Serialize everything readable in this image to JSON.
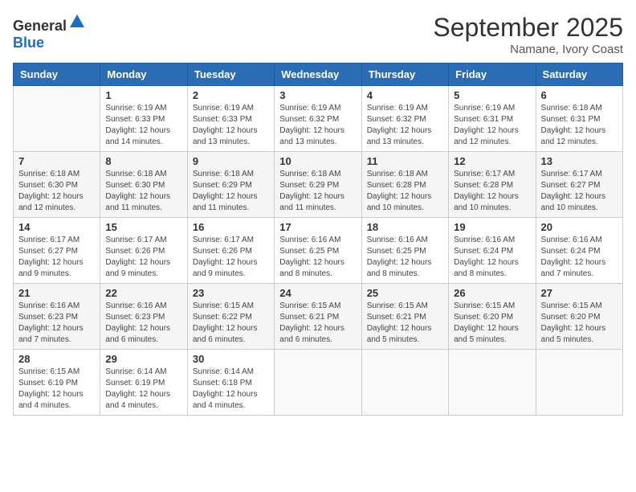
{
  "logo": {
    "general": "General",
    "blue": "Blue"
  },
  "title": "September 2025",
  "location": "Namane, Ivory Coast",
  "days_of_week": [
    "Sunday",
    "Monday",
    "Tuesday",
    "Wednesday",
    "Thursday",
    "Friday",
    "Saturday"
  ],
  "weeks": [
    [
      {
        "day": "",
        "info": ""
      },
      {
        "day": "1",
        "info": "Sunrise: 6:19 AM\nSunset: 6:33 PM\nDaylight: 12 hours\nand 14 minutes."
      },
      {
        "day": "2",
        "info": "Sunrise: 6:19 AM\nSunset: 6:33 PM\nDaylight: 12 hours\nand 13 minutes."
      },
      {
        "day": "3",
        "info": "Sunrise: 6:19 AM\nSunset: 6:32 PM\nDaylight: 12 hours\nand 13 minutes."
      },
      {
        "day": "4",
        "info": "Sunrise: 6:19 AM\nSunset: 6:32 PM\nDaylight: 12 hours\nand 13 minutes."
      },
      {
        "day": "5",
        "info": "Sunrise: 6:19 AM\nSunset: 6:31 PM\nDaylight: 12 hours\nand 12 minutes."
      },
      {
        "day": "6",
        "info": "Sunrise: 6:18 AM\nSunset: 6:31 PM\nDaylight: 12 hours\nand 12 minutes."
      }
    ],
    [
      {
        "day": "7",
        "info": ""
      },
      {
        "day": "8",
        "info": "Sunrise: 6:18 AM\nSunset: 6:30 PM\nDaylight: 12 hours\nand 11 minutes."
      },
      {
        "day": "9",
        "info": "Sunrise: 6:18 AM\nSunset: 6:29 PM\nDaylight: 12 hours\nand 11 minutes."
      },
      {
        "day": "10",
        "info": "Sunrise: 6:18 AM\nSunset: 6:29 PM\nDaylight: 12 hours\nand 11 minutes."
      },
      {
        "day": "11",
        "info": "Sunrise: 6:18 AM\nSunset: 6:28 PM\nDaylight: 12 hours\nand 10 minutes."
      },
      {
        "day": "12",
        "info": "Sunrise: 6:17 AM\nSunset: 6:28 PM\nDaylight: 12 hours\nand 10 minutes."
      },
      {
        "day": "13",
        "info": "Sunrise: 6:17 AM\nSunset: 6:27 PM\nDaylight: 12 hours\nand 10 minutes."
      }
    ],
    [
      {
        "day": "14",
        "info": ""
      },
      {
        "day": "15",
        "info": "Sunrise: 6:17 AM\nSunset: 6:26 PM\nDaylight: 12 hours\nand 9 minutes."
      },
      {
        "day": "16",
        "info": "Sunrise: 6:17 AM\nSunset: 6:26 PM\nDaylight: 12 hours\nand 9 minutes."
      },
      {
        "day": "17",
        "info": "Sunrise: 6:16 AM\nSunset: 6:25 PM\nDaylight: 12 hours\nand 8 minutes."
      },
      {
        "day": "18",
        "info": "Sunrise: 6:16 AM\nSunset: 6:25 PM\nDaylight: 12 hours\nand 8 minutes."
      },
      {
        "day": "19",
        "info": "Sunrise: 6:16 AM\nSunset: 6:24 PM\nDaylight: 12 hours\nand 8 minutes."
      },
      {
        "day": "20",
        "info": "Sunrise: 6:16 AM\nSunset: 6:24 PM\nDaylight: 12 hours\nand 7 minutes."
      }
    ],
    [
      {
        "day": "21",
        "info": ""
      },
      {
        "day": "22",
        "info": "Sunrise: 6:16 AM\nSunset: 6:23 PM\nDaylight: 12 hours\nand 6 minutes."
      },
      {
        "day": "23",
        "info": "Sunrise: 6:15 AM\nSunset: 6:22 PM\nDaylight: 12 hours\nand 6 minutes."
      },
      {
        "day": "24",
        "info": "Sunrise: 6:15 AM\nSunset: 6:21 PM\nDaylight: 12 hours\nand 6 minutes."
      },
      {
        "day": "25",
        "info": "Sunrise: 6:15 AM\nSunset: 6:21 PM\nDaylight: 12 hours\nand 5 minutes."
      },
      {
        "day": "26",
        "info": "Sunrise: 6:15 AM\nSunset: 6:20 PM\nDaylight: 12 hours\nand 5 minutes."
      },
      {
        "day": "27",
        "info": "Sunrise: 6:15 AM\nSunset: 6:20 PM\nDaylight: 12 hours\nand 5 minutes."
      }
    ],
    [
      {
        "day": "28",
        "info": "Sunrise: 6:15 AM\nSunset: 6:19 PM\nDaylight: 12 hours\nand 4 minutes."
      },
      {
        "day": "29",
        "info": "Sunrise: 6:14 AM\nSunset: 6:19 PM\nDaylight: 12 hours\nand 4 minutes."
      },
      {
        "day": "30",
        "info": "Sunrise: 6:14 AM\nSunset: 6:18 PM\nDaylight: 12 hours\nand 4 minutes."
      },
      {
        "day": "",
        "info": ""
      },
      {
        "day": "",
        "info": ""
      },
      {
        "day": "",
        "info": ""
      },
      {
        "day": "",
        "info": ""
      }
    ]
  ],
  "week7_sun_info": "Sunrise: 6:18 AM\nSunset: 6:30 PM\nDaylight: 12 hours\nand 12 minutes.",
  "week14_sun_info": "Sunrise: 6:17 AM\nSunset: 6:27 PM\nDaylight: 12 hours\nand 9 minutes.",
  "week21_sun_info": "Sunrise: 6:16 AM\nSunset: 6:23 PM\nDaylight: 12 hours\nand 7 minutes."
}
